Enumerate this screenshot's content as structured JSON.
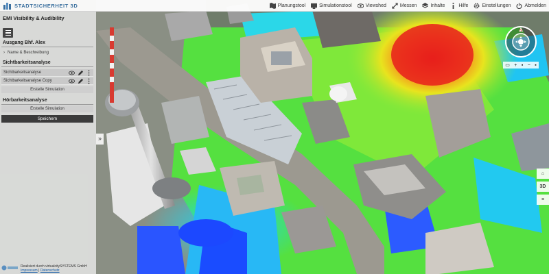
{
  "app": {
    "logo_text": "STADTSICHERHEIT 3D"
  },
  "nav": [
    {
      "icon": "map-icon",
      "label": "Planungstool"
    },
    {
      "icon": "simulation-icon",
      "label": "Simulationstool"
    },
    {
      "icon": "eye-icon",
      "label": "Viewshed"
    },
    {
      "icon": "measure-icon",
      "label": "Messen"
    },
    {
      "icon": "content-icon",
      "label": "Inhalte"
    },
    {
      "icon": "info-icon",
      "label": "Hilfe"
    },
    {
      "icon": "gear-icon",
      "label": "Einstellungen"
    },
    {
      "icon": "power-icon",
      "label": "Abmelden"
    }
  ],
  "panel": {
    "title": "EMI Visibility & Audibility",
    "area_title": "Ausgang Bhf. Alex",
    "name_description": "Name & Beschreibung",
    "visibility": {
      "heading": "Sichtbarkeitsanalyse",
      "rows": [
        "Sichtbarkeitsanalyse",
        "Sichtbarkeitsanalyse Copy"
      ],
      "create_button": "Erstelle Simulation"
    },
    "audibility": {
      "heading": "Hörbarkeitsanalyse",
      "create_button": "Erstelle Simulation"
    },
    "save_button": "Speichern",
    "collapse_label": "»"
  },
  "footer": {
    "line1": "Realisiert durch virtualcitySYSTEMS GmbH",
    "impressum": "Impressum",
    "separator": " | ",
    "datenschutz": "Datenschutz"
  },
  "controls": {
    "zoom_in": "+",
    "zoom_out": "−",
    "compass_north": "N",
    "home_label": "⌂",
    "mode_3d": "3D",
    "layers_label": "≡"
  },
  "colors": {
    "accent": "#3a6f9e",
    "save_button": "#3b3b3b",
    "heatmap_high": "#e8201c",
    "heatmap_low": "#1a3cff"
  }
}
